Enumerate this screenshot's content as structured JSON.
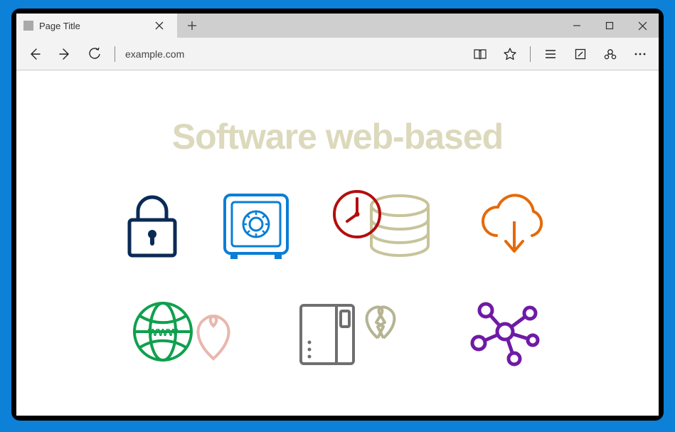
{
  "browser": {
    "tab_title": "Page Title",
    "address": "example.com"
  },
  "page": {
    "heading": "Software web-based"
  },
  "icons_row1": [
    {
      "name": "lock-icon",
      "color": "#0b2a55"
    },
    {
      "name": "safe-icon",
      "color": "#0a7ed6"
    },
    {
      "name": "clock-database-icon",
      "clock_color": "#b30e0e",
      "db_color": "#c7c49a"
    },
    {
      "name": "cloud-download-icon",
      "color": "#e46a0a"
    }
  ],
  "icons_row2": [
    {
      "name": "www-heart-icon",
      "globe_color": "#0fa04d",
      "heart_color": "#e8b7ad"
    },
    {
      "name": "server-broken-heart-icon",
      "server_color": "#6f6f6f",
      "heart_color": "#b6b393"
    },
    {
      "name": "network-graph-icon",
      "color": "#6f1aa6"
    }
  ]
}
